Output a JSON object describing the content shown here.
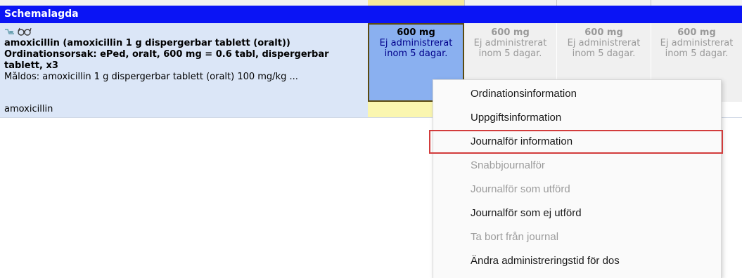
{
  "section": {
    "title": "Schemalagda"
  },
  "order": {
    "drug_title": "amoxicillin (amoxicillin 1 g dispergerbar tablett (oralt))",
    "reason": "Ordinationsorsak: ePed, oralt, 600 mg = 0.6 tabl, dispergerbar tablett, x3",
    "target_dose": "Måldos: amoxicillin 1 g dispergerbar tablett (oralt) 100 mg/kg ...",
    "generic_name": "amoxicillin",
    "icons": [
      "pill-icon",
      "glasses-icon"
    ]
  },
  "doses": [
    {
      "amount": "600 mg",
      "status": "Ej administrerat inom 5 dagar.",
      "state": "active"
    },
    {
      "amount": "600 mg",
      "status": "Ej administrerat inom 5 dagar.",
      "state": "inactive"
    },
    {
      "amount": "600 mg",
      "status": "Ej administrerat inom 5 dagar.",
      "state": "inactive"
    },
    {
      "amount": "600 mg",
      "status": "Ej administrerat inom 5 dagar.",
      "state": "inactive"
    }
  ],
  "context_menu": {
    "items": [
      {
        "label": "Ordinationsinformation",
        "enabled": true,
        "highlighted": false
      },
      {
        "label": "Uppgiftsinformation",
        "enabled": true,
        "highlighted": false
      },
      {
        "label": "Journalför information",
        "enabled": true,
        "highlighted": true
      },
      {
        "label": "Snabbjournalför",
        "enabled": false,
        "highlighted": false
      },
      {
        "label": "Journalför som utförd",
        "enabled": false,
        "highlighted": false
      },
      {
        "label": "Journalför som ej utförd",
        "enabled": true,
        "highlighted": false
      },
      {
        "label": "Ta bort från journal",
        "enabled": false,
        "highlighted": false
      },
      {
        "label": "Ändra administreringstid för dos",
        "enabled": true,
        "highlighted": false
      }
    ]
  },
  "colors": {
    "section_header_bg": "#0a14f5",
    "row_bg": "#dbe6f7",
    "active_dose_bg": "#8ab0f0",
    "highlight_outline": "#d23c3c"
  }
}
